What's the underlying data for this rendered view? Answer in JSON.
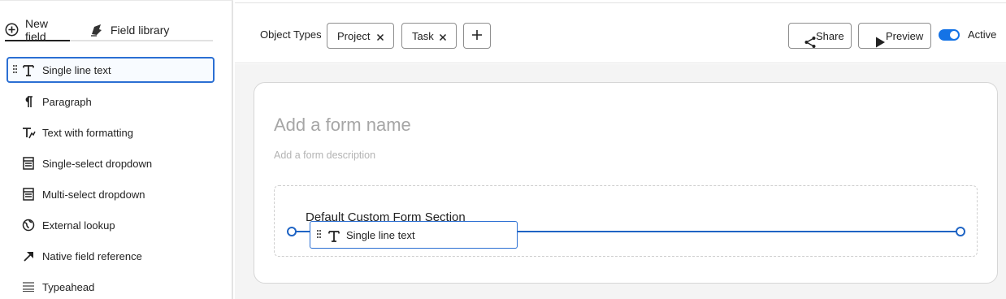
{
  "left_panel": {
    "tabs": [
      {
        "label": "New field",
        "icon": "plus-circle-icon",
        "active": true
      },
      {
        "label": "Field library",
        "icon": "field-library-icon",
        "active": false
      }
    ],
    "fields": [
      {
        "label": "Single line text",
        "icon": "text-t-icon",
        "selected": true
      },
      {
        "label": "Paragraph",
        "icon": "pilcrow-icon"
      },
      {
        "label": "Text with formatting",
        "icon": "text-format-icon"
      },
      {
        "label": "Single-select dropdown",
        "icon": "dropdown-list-icon"
      },
      {
        "label": "Multi-select dropdown",
        "icon": "dropdown-list-icon"
      },
      {
        "label": "External lookup",
        "icon": "globe-icon"
      },
      {
        "label": "Native field reference",
        "icon": "arrow-reference-icon"
      },
      {
        "label": "Typeahead",
        "icon": "typeahead-lines-icon"
      }
    ]
  },
  "header": {
    "object_types_label": "Object Types",
    "object_types": [
      "Project",
      "Task"
    ],
    "share_label": "Share",
    "preview_label": "Preview",
    "active_label": "Active",
    "active_on": true,
    "accent_color": "#1473e6"
  },
  "form": {
    "name_placeholder": "Add a form name",
    "description_placeholder": "Add a form description",
    "section_title": "Default Custom Form Section",
    "dragging_field_label": "Single line text",
    "drop_indicator_color": "#1f64c4"
  }
}
